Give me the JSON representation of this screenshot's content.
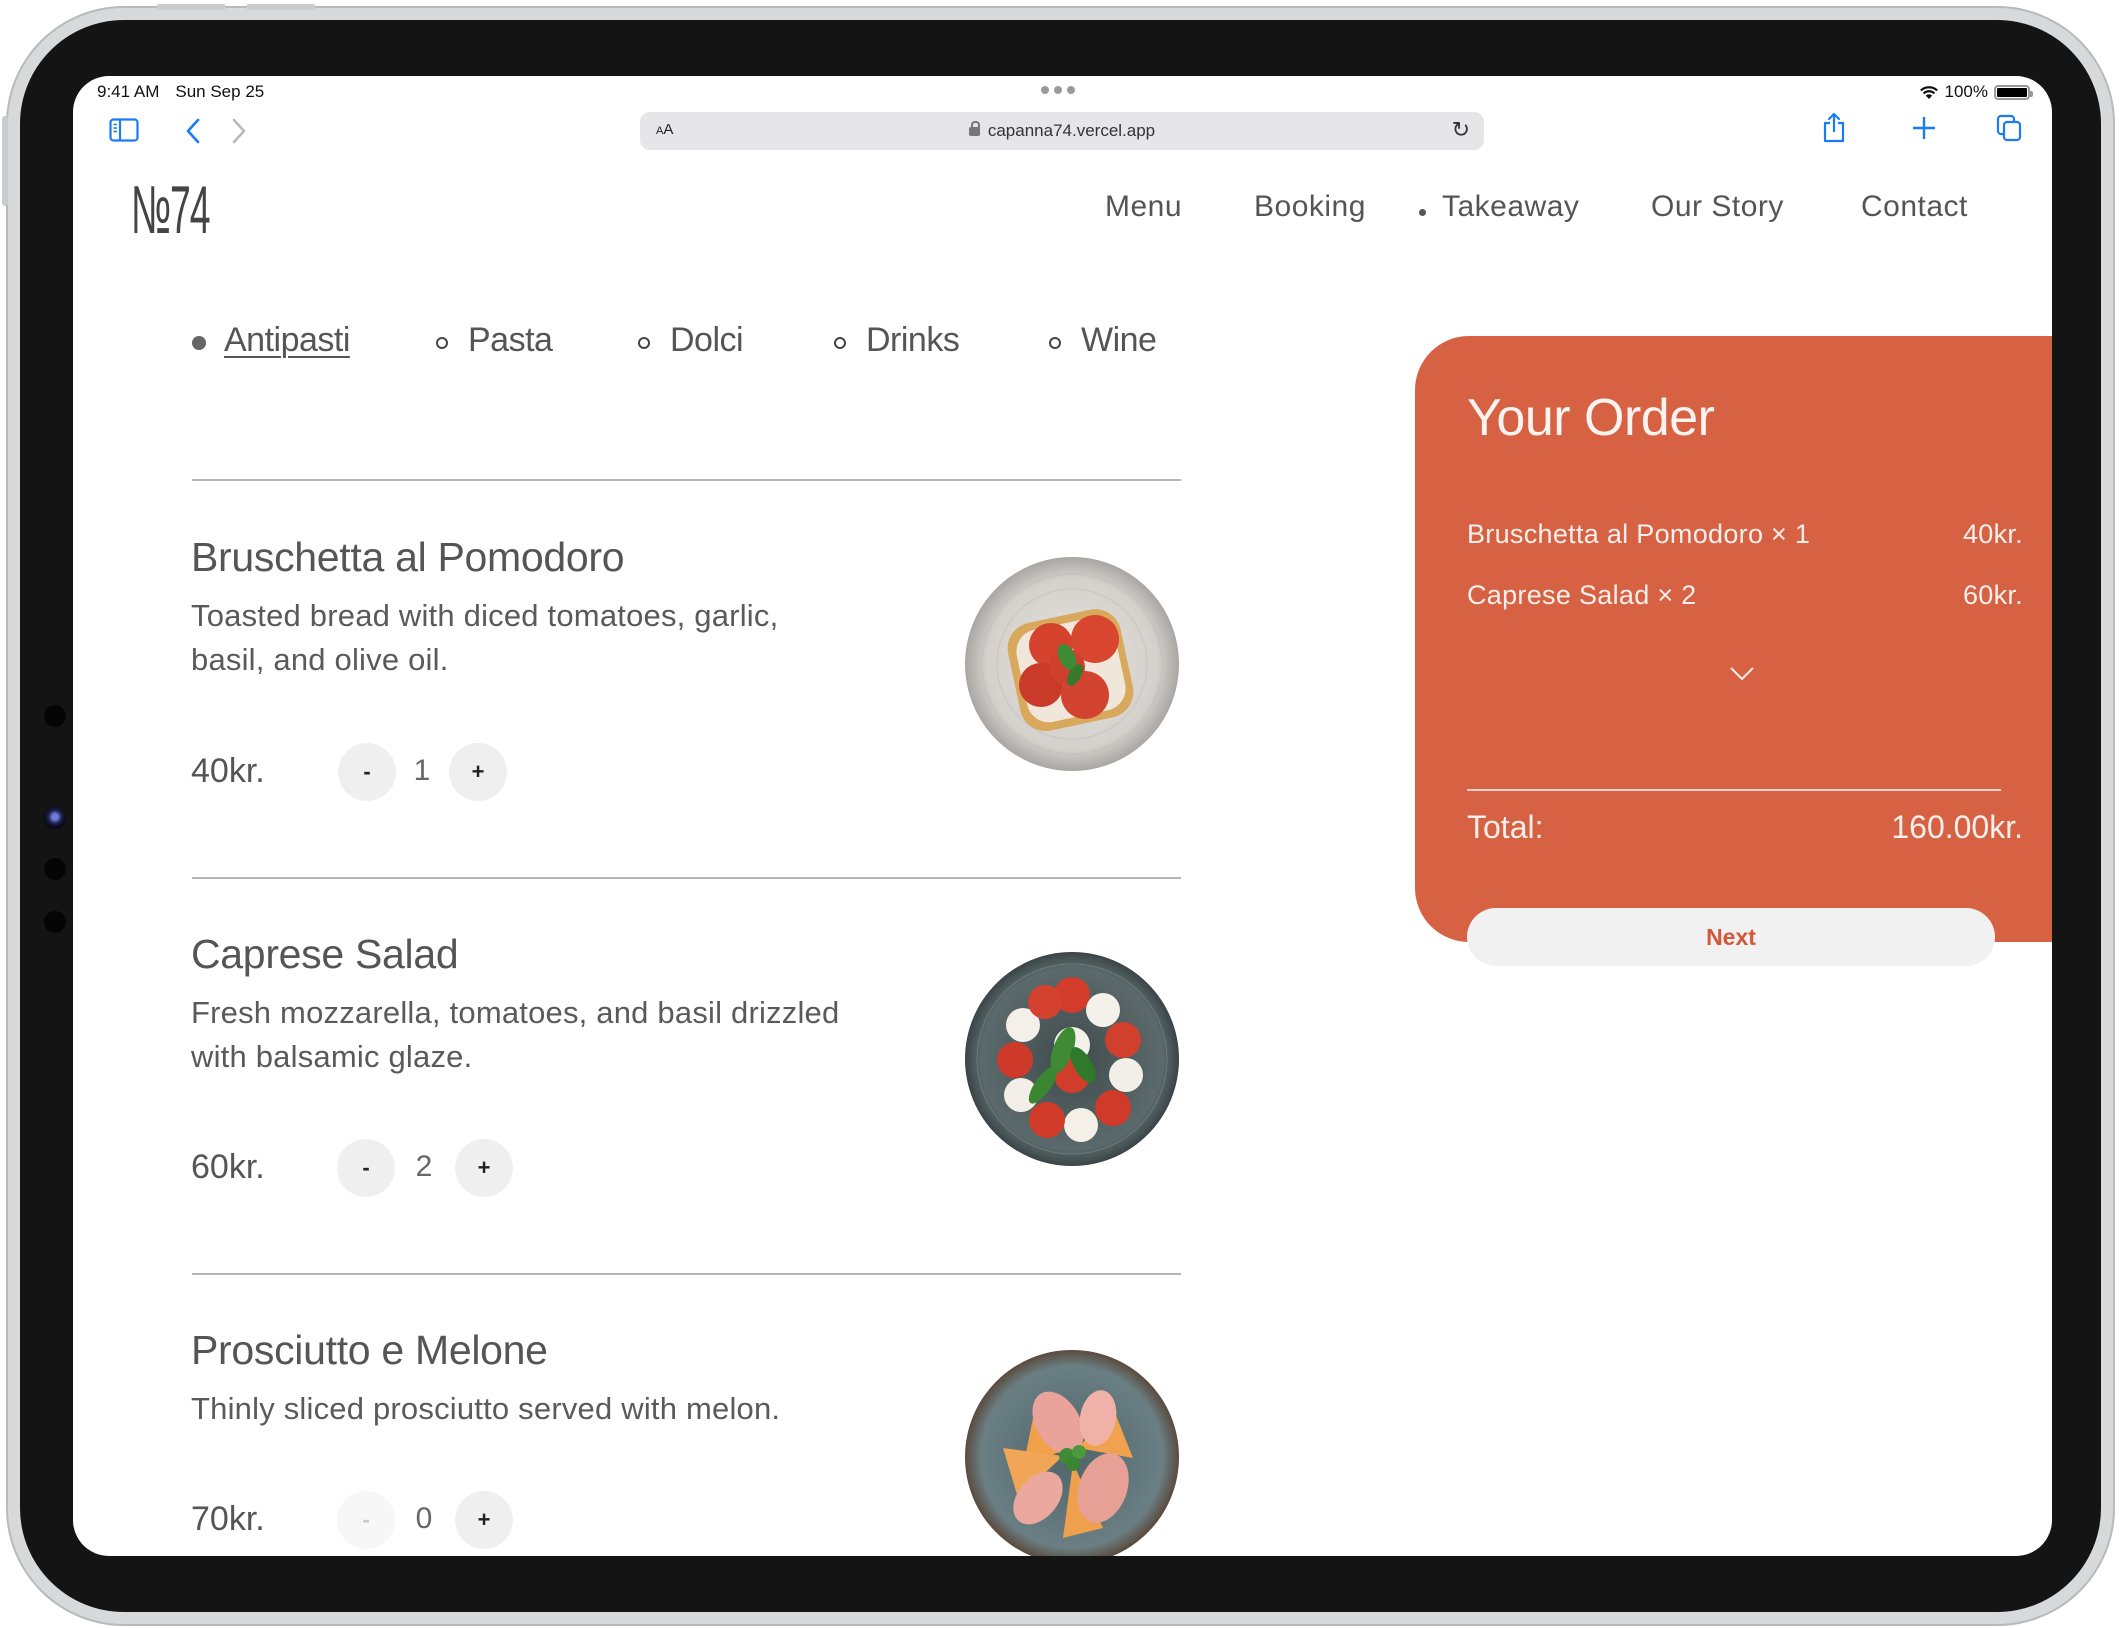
{
  "status_bar": {
    "time": "9:41 AM",
    "date": "Sun Sep 25",
    "battery": "100%",
    "battery_level": 1.0
  },
  "browser": {
    "text_size_label": "AA",
    "url": "capanna74.vercel.app",
    "icons": {
      "sidebar": "sidebar-icon",
      "back": "chevron-left-icon",
      "forward": "chevron-right-icon",
      "lock": "lock-icon",
      "reload": "reload-icon",
      "share": "share-icon",
      "new_tab": "plus-icon",
      "tabs": "tabs-icon"
    }
  },
  "site": {
    "logo": "№74",
    "nav": [
      {
        "label": "Menu",
        "active": false
      },
      {
        "label": "Booking",
        "active": false
      },
      {
        "label": "Takeaway",
        "active": true
      },
      {
        "label": "Our Story",
        "active": false
      },
      {
        "label": "Contact",
        "active": false
      }
    ]
  },
  "categories": [
    {
      "label": "Antipasti",
      "active": true
    },
    {
      "label": "Pasta",
      "active": false
    },
    {
      "label": "Dolci",
      "active": false
    },
    {
      "label": "Drinks",
      "active": false
    },
    {
      "label": "Wine",
      "active": false
    }
  ],
  "menu_items": [
    {
      "name": "Bruschetta al Pomodoro",
      "description_lines": [
        "Toasted bread with diced tomatoes, garlic,",
        "basil, and olive oil."
      ],
      "price": "40kr.",
      "quantity": "1",
      "minus_label": "-",
      "plus_label": "+",
      "image": "bruschetta-dish-image"
    },
    {
      "name": "Caprese Salad",
      "description_lines": [
        "Fresh mozzarella, tomatoes, and basil drizzled",
        "with balsamic glaze."
      ],
      "price": "60kr.",
      "quantity": "2",
      "minus_label": "-",
      "plus_label": "+",
      "image": "caprese-dish-image"
    },
    {
      "name": "Prosciutto e Melone",
      "description_lines": [
        "Thinly sliced prosciutto served with melon."
      ],
      "price": "70kr.",
      "quantity": "0",
      "minus_label": "-",
      "plus_label": "+",
      "image": "prosciutto-dish-image"
    }
  ],
  "order": {
    "title": "Your Order",
    "lines": [
      {
        "label": "Bruschetta al Pomodoro × 1",
        "amount": "40kr."
      },
      {
        "label": "Caprese Salad × 2",
        "amount": "60kr."
      }
    ],
    "expand_icon": "chevron-down-icon",
    "total_label": "Total:",
    "total_value": "160.00kr.",
    "next_label": "Next"
  },
  "colors": {
    "accent": "#d76243",
    "next_text": "#d4573a",
    "browser_blue": "#1a7cf5",
    "text_gray": "#555555"
  }
}
